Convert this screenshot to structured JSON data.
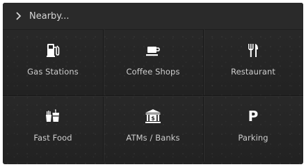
{
  "header": {
    "title": "Nearby...",
    "back_icon": "chevron-right-icon"
  },
  "categories": [
    {
      "label": "Gas Stations",
      "icon": "gas-pump-icon"
    },
    {
      "label": "Coffee Shops",
      "icon": "coffee-cup-icon"
    },
    {
      "label": "Restaurant",
      "icon": "fork-knife-icon"
    },
    {
      "label": "Fast Food",
      "icon": "fast-food-icon"
    },
    {
      "label": "ATMs / Banks",
      "icon": "bank-icon"
    },
    {
      "label": "Parking",
      "icon": "parking-icon",
      "glyph": "P"
    }
  ],
  "colors": {
    "background": "#242424",
    "text": "#cfcfcf",
    "icon": "#ffffff"
  }
}
